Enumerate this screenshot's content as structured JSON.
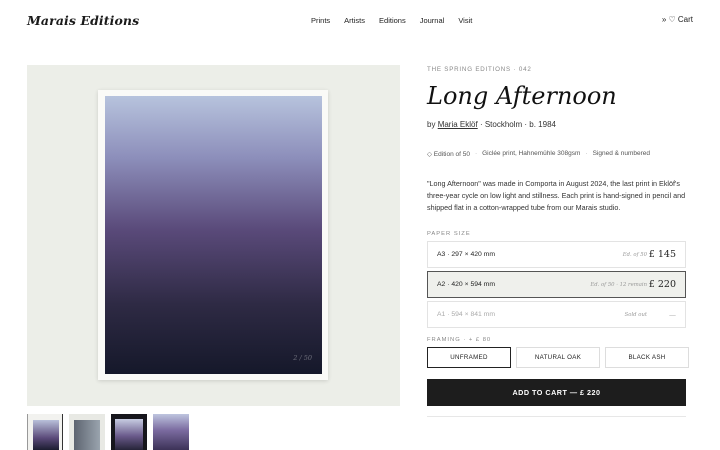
{
  "brand": "Marais Editions",
  "nav": [
    "Prints",
    "Artists",
    "Editions",
    "Journal",
    "Visit"
  ],
  "cart": "» ♡ Cart",
  "product": {
    "eyebrow": "THE SPRING EDITIONS · 042",
    "title": "Long Afternoon",
    "by": "by",
    "artist": "Maria Eklöf",
    "artist_meta": "· Stockholm · b. 1984",
    "specs": [
      "◇ Edition of 50",
      "Giclée print, Hahnemühle 308gsm",
      "Signed & numbered"
    ],
    "description": "\"Long Afternoon\" was made in Comporta in August 2024, the last print in Eklöf's three-year cycle on low light and stillness. Each print is hand-signed in pencil and shipped flat in a cotton-wrapped tube from our Marais studio.",
    "edition_stamp": "2 / 50"
  },
  "paper_size": {
    "label": "PAPER SIZE",
    "options": [
      {
        "name": "A3 · 297 × 420 mm",
        "edition": "Ed. of 50",
        "price": "£ 145",
        "state": "available"
      },
      {
        "name": "A2 · 420 × 594 mm",
        "edition": "Ed. of 50 · 12 remain",
        "price": "£ 220",
        "state": "selected"
      },
      {
        "name": "A1 · 594 × 841 mm",
        "edition": "Sold out",
        "price": "—",
        "state": "soldout"
      }
    ]
  },
  "framing": {
    "label": "FRAMING · + £ 80",
    "options": [
      "UNFRAMED",
      "NATURAL OAK",
      "BLACK ASH"
    ],
    "selected": "UNFRAMED"
  },
  "add_to_cart": "ADD TO CART — £ 220"
}
